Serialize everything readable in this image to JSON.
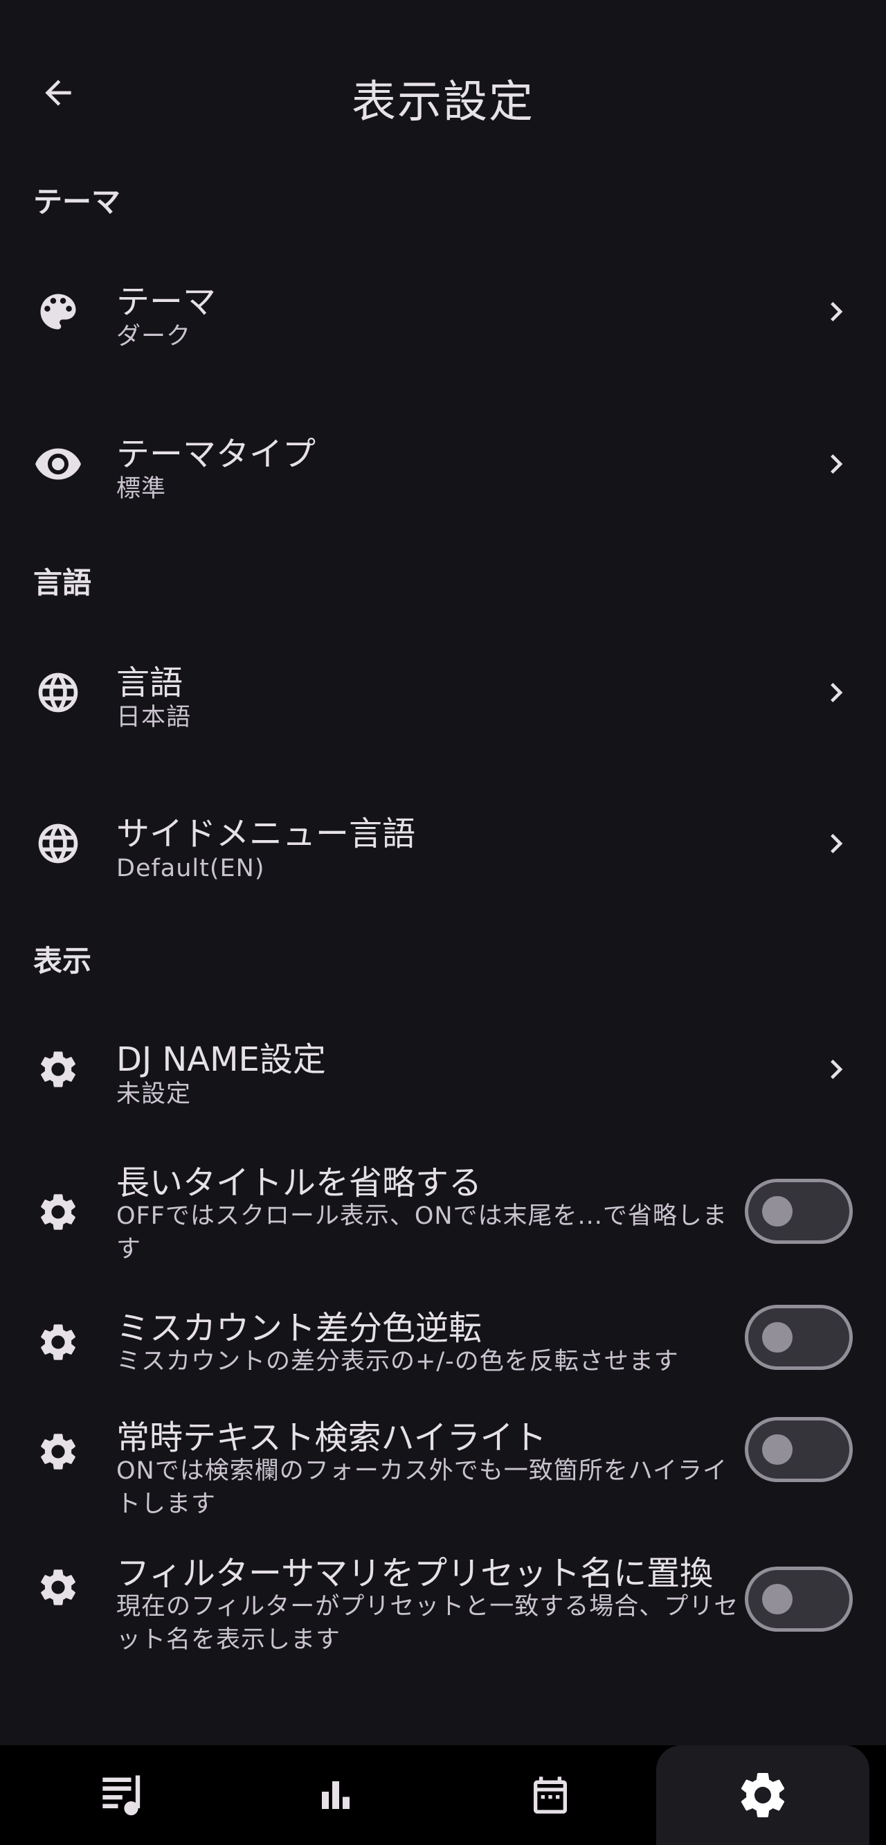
{
  "header": {
    "title": "表示設定",
    "back_icon": "arrow-back-icon"
  },
  "sections": {
    "theme": {
      "header": "テーマ",
      "items": [
        {
          "title": "テーマ",
          "subtitle": "ダーク",
          "icon": "palette-icon"
        },
        {
          "title": "テーマタイプ",
          "subtitle": "標準",
          "icon": "eye-icon"
        }
      ]
    },
    "language": {
      "header": "言語",
      "items": [
        {
          "title": "言語",
          "subtitle": "日本語",
          "icon": "globe-icon"
        },
        {
          "title": "サイドメニュー言語",
          "subtitle": "Default(EN)",
          "icon": "globe-icon"
        }
      ]
    },
    "display": {
      "header": "表示",
      "items": [
        {
          "title": "DJ NAME設定",
          "subtitle": "未設定",
          "icon": "gear-icon"
        },
        {
          "title": "長いタイトルを省略する",
          "subtitle": "OFFではスクロール表示、ONでは末尾を...で省略します",
          "icon": "gear-icon",
          "toggle": false
        },
        {
          "title": "ミスカウント差分色逆転",
          "subtitle": "ミスカウントの差分表示の+/-の色を反転させます",
          "icon": "gear-icon",
          "toggle": false
        },
        {
          "title": "常時テキスト検索ハイライト",
          "subtitle": "ONでは検索欄のフォーカス外でも一致箇所をハイライトします",
          "icon": "gear-icon",
          "toggle": false
        },
        {
          "title": "フィルターサマリをプリセット名に置換",
          "subtitle": "現在のフィルターがプリセットと一致する場合、プリセット名を表示します",
          "icon": "gear-icon",
          "toggle": false
        }
      ]
    }
  },
  "bottom_nav": {
    "items": [
      {
        "icon": "music-list-icon",
        "active": false
      },
      {
        "icon": "bar-chart-icon",
        "active": false
      },
      {
        "icon": "calendar-icon",
        "active": false
      },
      {
        "icon": "gear-icon",
        "active": true
      }
    ]
  },
  "colors": {
    "background": "#141318",
    "text_primary": "#e6e1e6",
    "text_secondary": "#cac4cf",
    "toggle_outline": "#938f99",
    "nav_background": "#000000"
  }
}
